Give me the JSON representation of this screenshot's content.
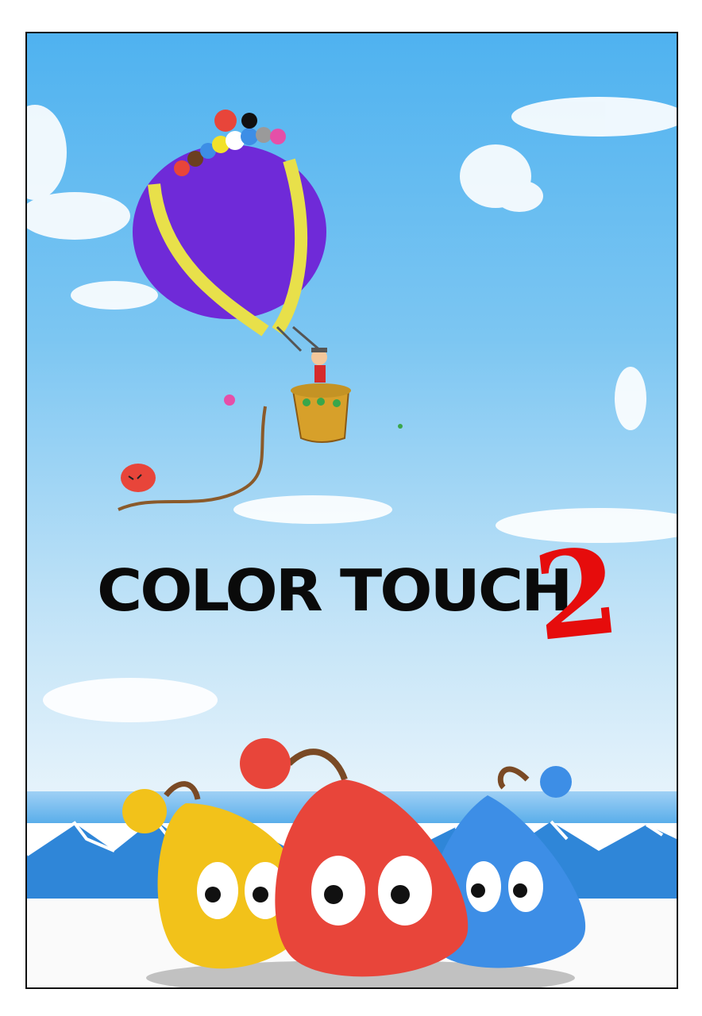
{
  "cover": {
    "title_word": "COLOR TOUCH",
    "title_number": "2"
  },
  "colors": {
    "sky_top": "#4fb2f0",
    "balloon": "#6f2ad8",
    "balloon_stripe": "#e8e04a",
    "title_number": "#e60c0c",
    "blob_yellow": "#f2c21a",
    "blob_red": "#e8453a",
    "blob_blue": "#3d8ee6"
  },
  "characters": [
    "yellow-blob",
    "red-blob",
    "blue-blob"
  ],
  "icons": [
    "hot-air-balloon-icon",
    "basket-icon",
    "pilot-icon",
    "flying-blob-icon"
  ]
}
